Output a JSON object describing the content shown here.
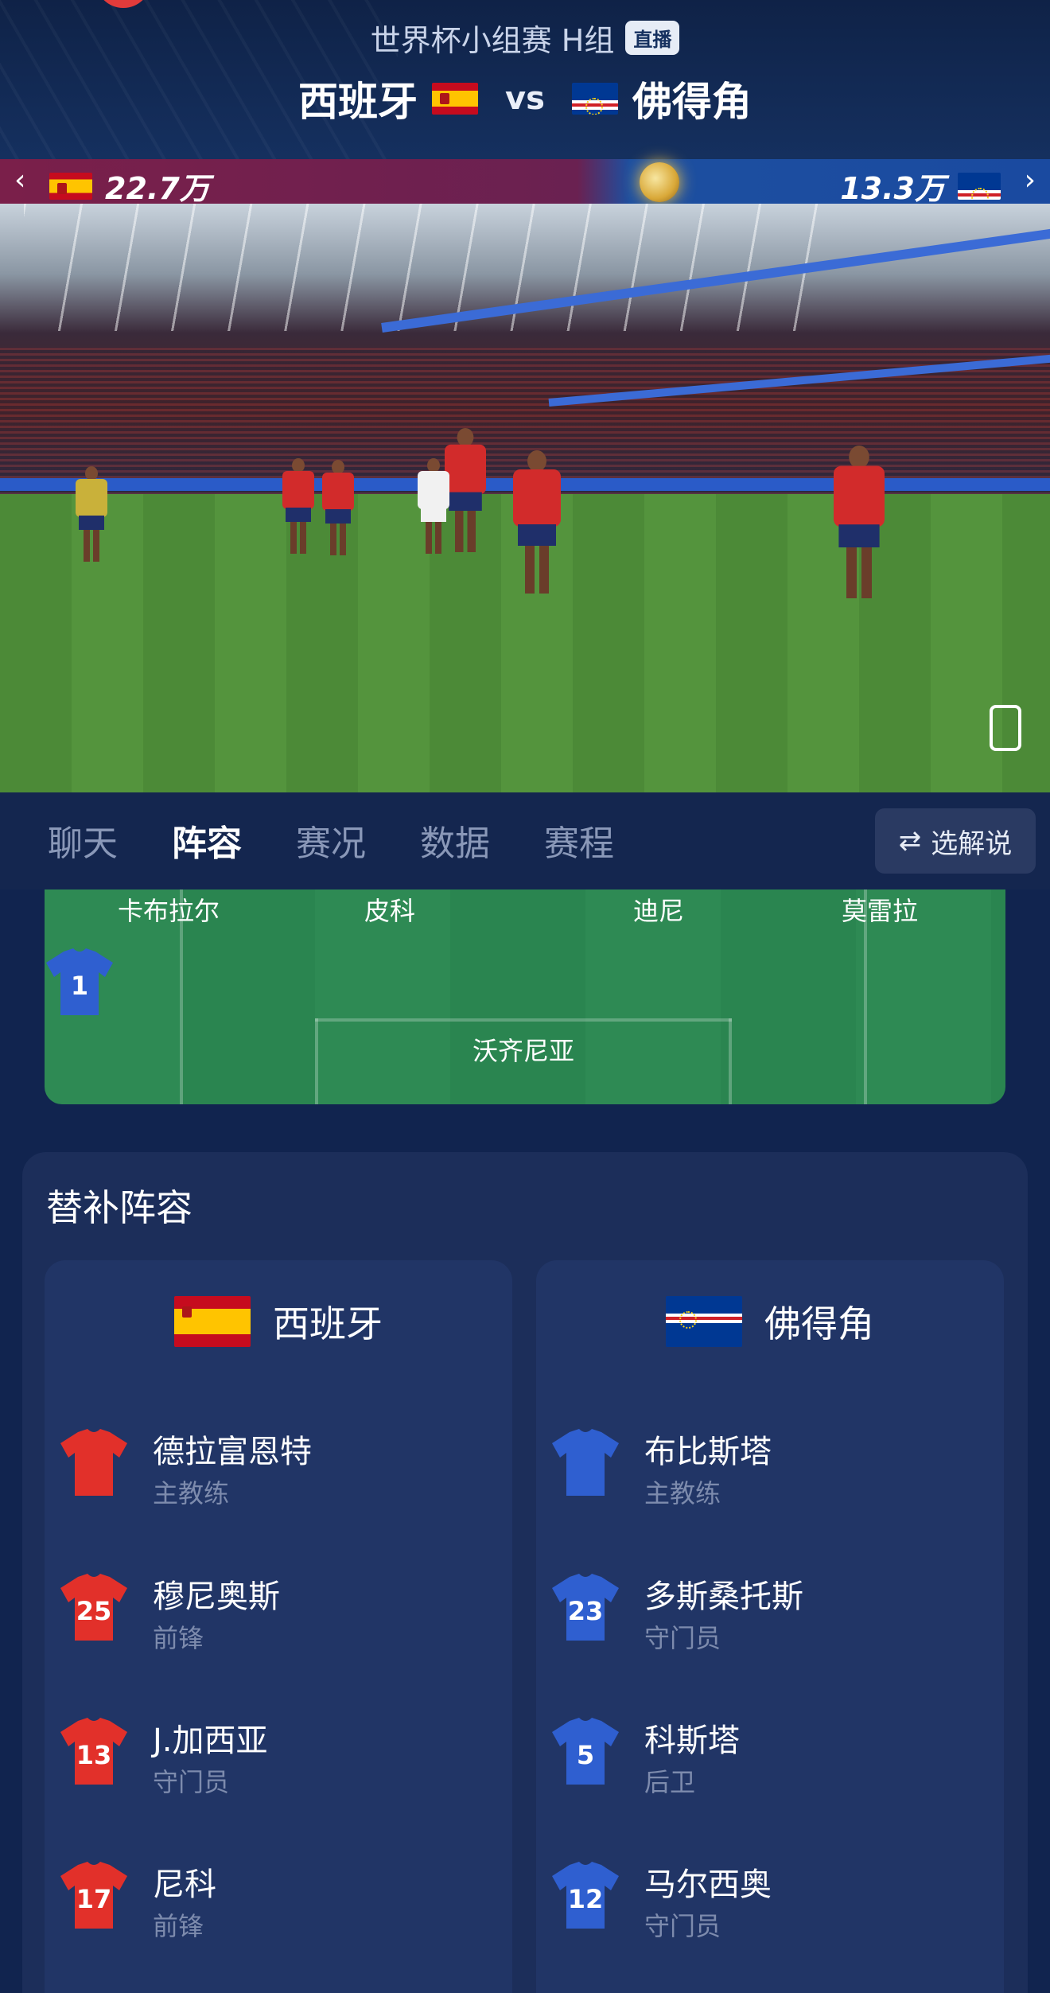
{
  "header": {
    "title": "世界杯小组赛 H组",
    "live_badge": "直播",
    "home_team": "西班牙",
    "vs": "vs",
    "away_team": "佛得角"
  },
  "vote_bar": {
    "home_count": "22.7万",
    "away_count": "13.3万",
    "prev_icon": "chevron-left-icon",
    "next_icon": "chevron-right-icon"
  },
  "tabs": [
    {
      "label": "聊天",
      "active": false
    },
    {
      "label": "阵容",
      "active": true
    },
    {
      "label": "赛况",
      "active": false
    },
    {
      "label": "数据",
      "active": false
    },
    {
      "label": "赛程",
      "active": false
    }
  ],
  "commentary_button": {
    "label": "选解说",
    "icon": "swap-arrows-icon"
  },
  "lineup_pitch": {
    "defenders": [
      "卡布拉尔",
      "皮科",
      "迪尼",
      "莫雷拉"
    ],
    "goalkeeper": {
      "number": "1",
      "name": "沃齐尼亚"
    }
  },
  "subs": {
    "title": "替补阵容",
    "home": {
      "team": "西班牙",
      "players": [
        {
          "number": "",
          "name": "德拉富恩特",
          "role": "主教练"
        },
        {
          "number": "25",
          "name": "穆尼奥斯",
          "role": "前锋"
        },
        {
          "number": "13",
          "name": "J.加西亚",
          "role": "守门员"
        },
        {
          "number": "17",
          "name": "尼科",
          "role": "前锋"
        }
      ]
    },
    "away": {
      "team": "佛得角",
      "players": [
        {
          "number": "",
          "name": "布比斯塔",
          "role": "主教练"
        },
        {
          "number": "23",
          "name": "多斯桑托斯",
          "role": "守门员"
        },
        {
          "number": "5",
          "name": "科斯塔",
          "role": "后卫"
        },
        {
          "number": "12",
          "name": "马尔西奥",
          "role": "守门员"
        }
      ]
    }
  },
  "colors": {
    "home_jersey": "#e2302a",
    "away_jersey": "#2f5fd0",
    "background": "#11244f"
  }
}
